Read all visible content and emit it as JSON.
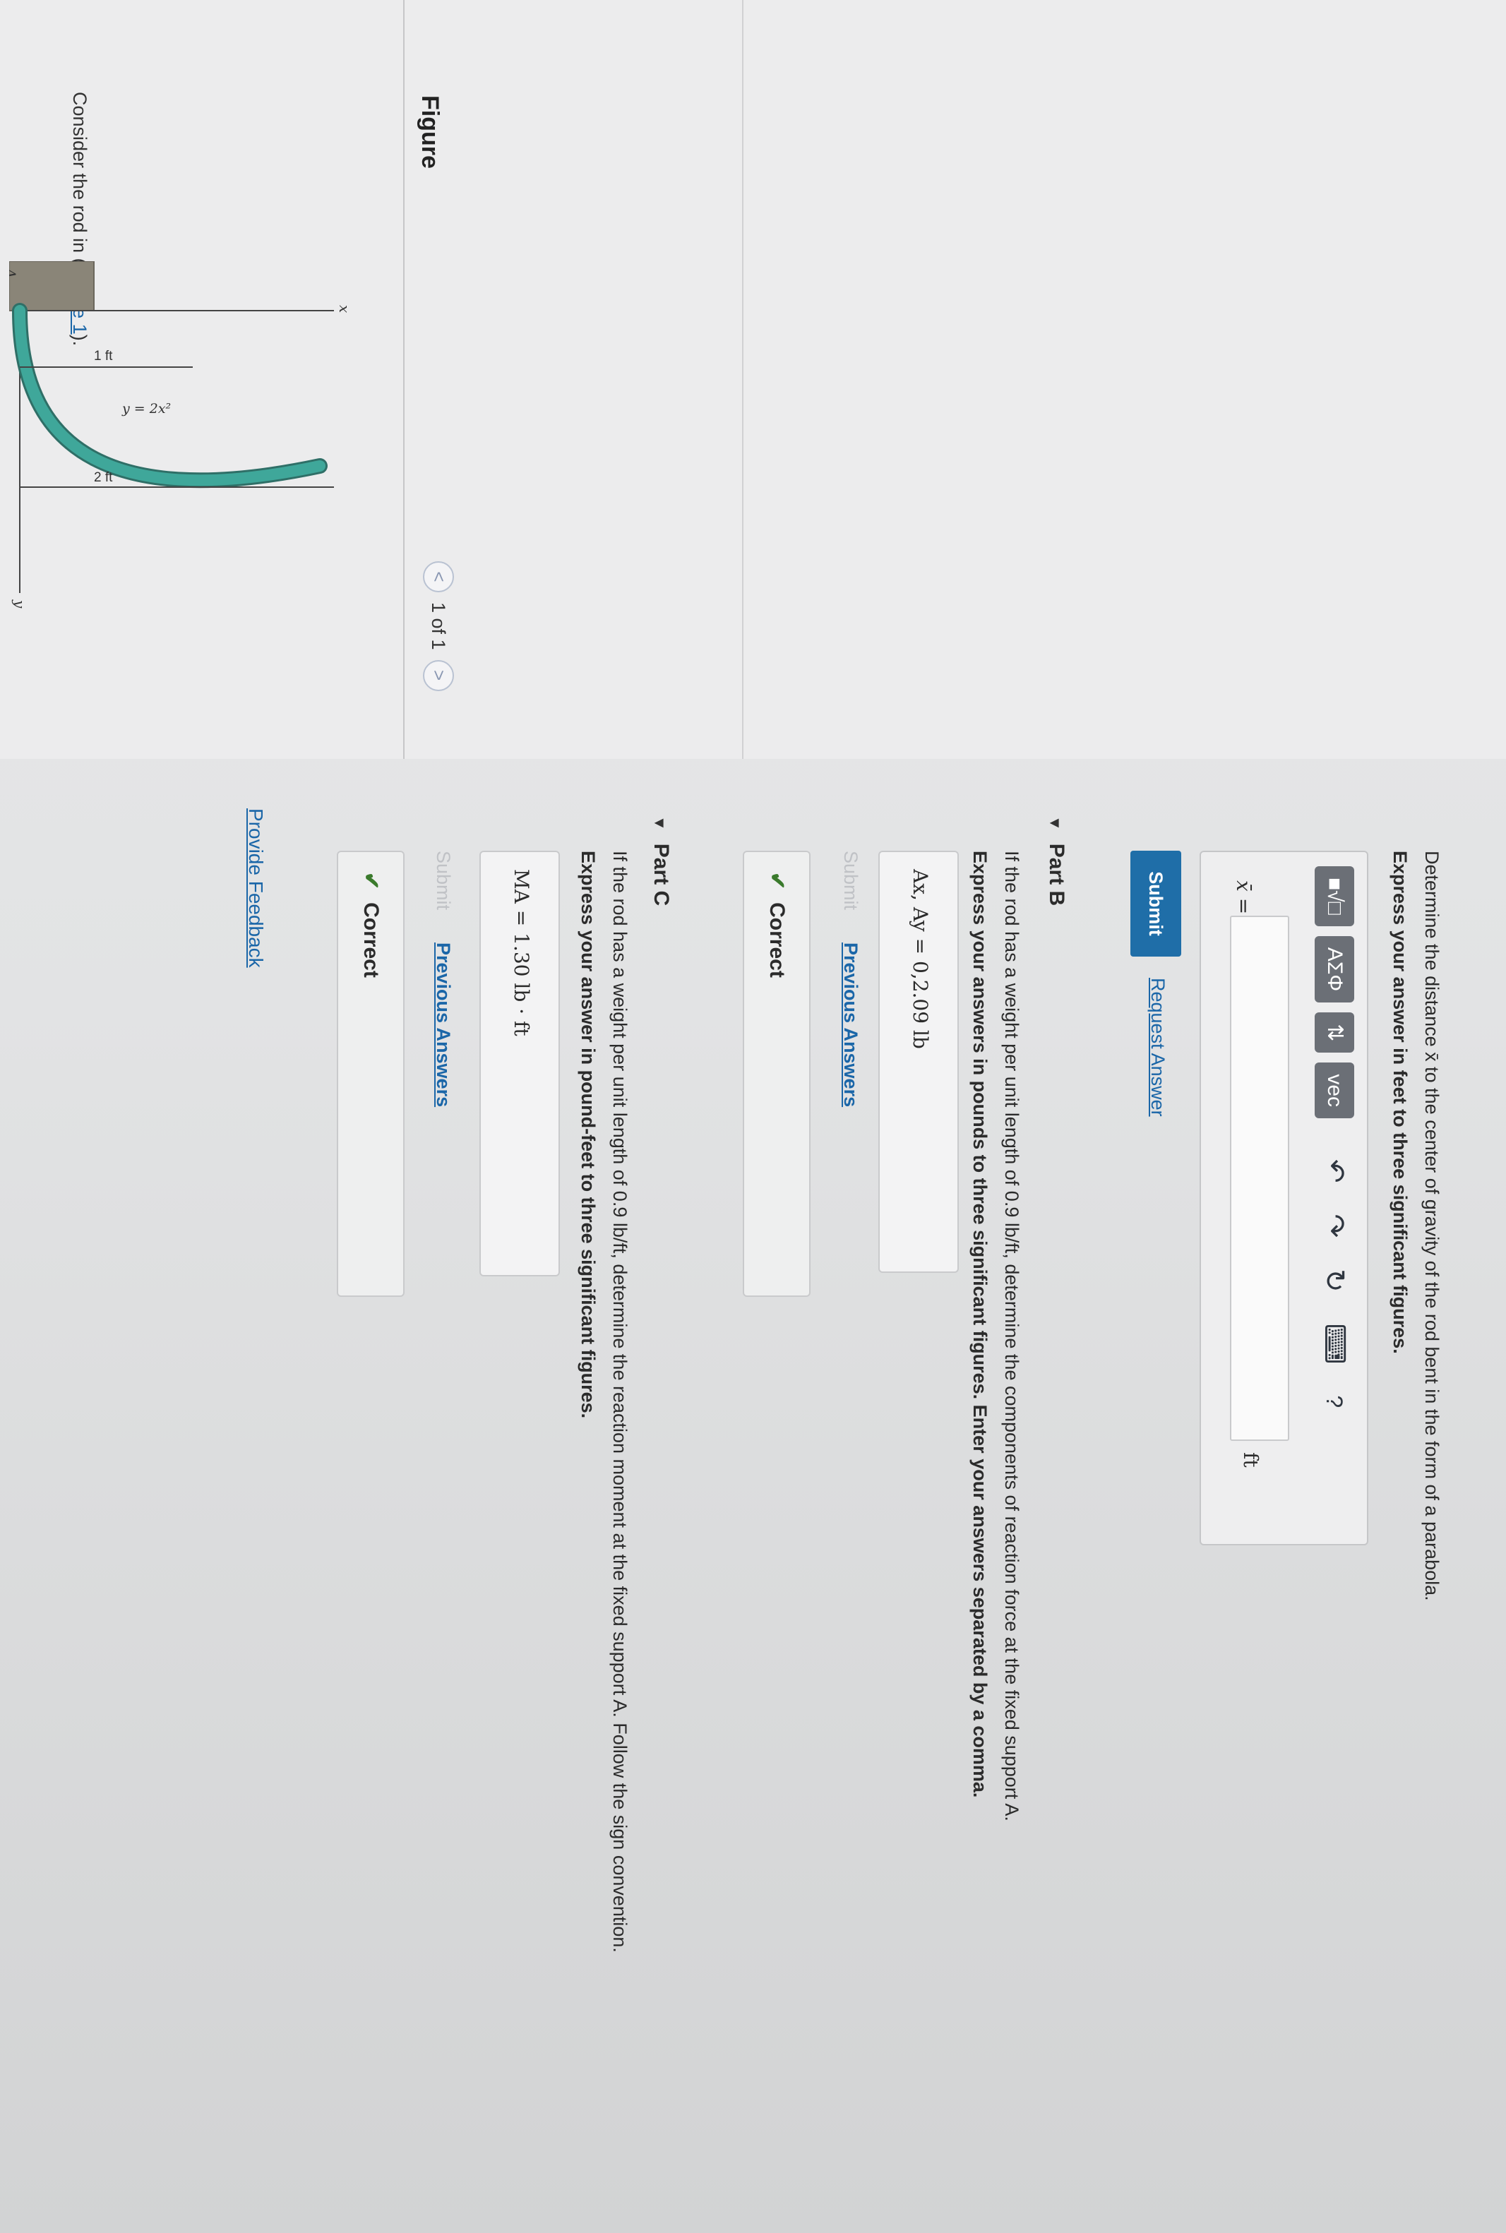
{
  "intro": {
    "prefix": "Consider the rod in (",
    "link": "Figure 1",
    "suffix": ")."
  },
  "figure": {
    "title": "Figure",
    "pager": {
      "text": "1 of 1",
      "prev": "<",
      "next": ">"
    },
    "labels": {
      "y_axis": "y",
      "x_axis": "x",
      "point": "A",
      "equation": "y = 2x²",
      "width_1": "1 ft",
      "width_2": "2 ft"
    },
    "colors": {
      "rod": "#3fa79a",
      "support": "#8a8578"
    }
  },
  "partA": {
    "question": "Determine the distance x̄ to the center of gravity of the rod bent in the form of a parabola.",
    "instructions": "Express your answer in feet to three significant figures.",
    "toolbar": {
      "template": "■√□",
      "greek": "ΑΣΦ",
      "arrows": "⇅",
      "vec": "vec",
      "undo": "↶",
      "redo": "↷",
      "reset": "↻",
      "keyboard": "⌨",
      "help": "?"
    },
    "input_label": "x̄ =",
    "input_value": "",
    "unit": "ft",
    "submit": "Submit",
    "request_answer": "Request Answer"
  },
  "partB": {
    "title": "Part B",
    "question": "If the rod has a weight per unit length of 0.9 lb/ft, determine the components of reaction force at the fixed support A.",
    "instructions": "Express your answers in pounds to three significant figures. Enter your answers separated by a comma.",
    "answer": "Ax, Ay =  0,2.09  lb",
    "submit": "Submit",
    "previous_answers": "Previous Answers",
    "status": "Correct"
  },
  "partC": {
    "title": "Part C",
    "question": "If the rod has a weight per unit length of 0.9 lb/ft, determine the reaction moment at the fixed support A. Follow the sign convention.",
    "instructions": "Express your answer in pound-feet to three significant figures.",
    "answer": "MA =  1.30  lb · ft",
    "submit": "Submit",
    "previous_answers": "Previous Answers",
    "status": "Correct"
  },
  "feedback": "Provide Feedback",
  "colors": {
    "link": "#1a66a8",
    "submit_bg": "#1f6ea8",
    "correct": "#3a7a2c"
  }
}
